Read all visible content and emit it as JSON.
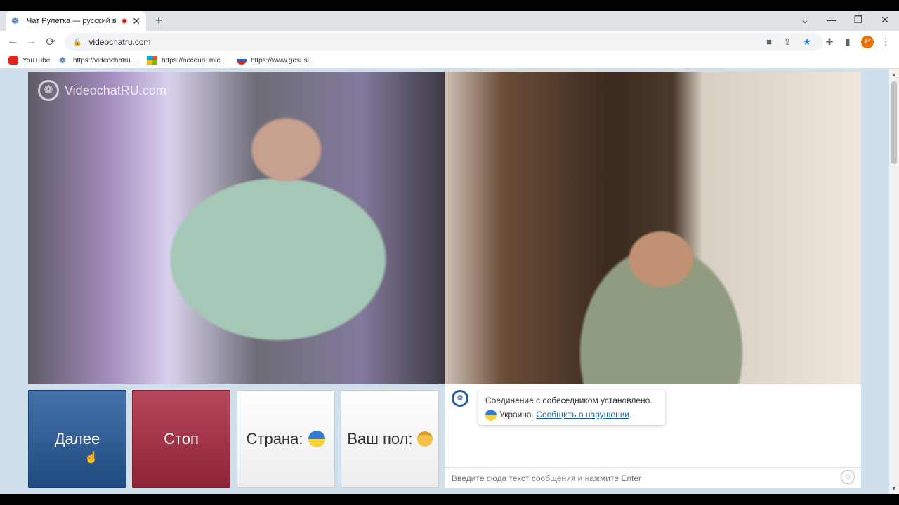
{
  "browser": {
    "tab_title": "Чат Рулетка — русский вид",
    "close_glyph": "✕",
    "new_tab_glyph": "+",
    "url": "videochatru.com",
    "profile_initial": "P",
    "window_controls": {
      "minimize": "—",
      "restore": "❐",
      "close": "✕",
      "tab_search": "⌄"
    },
    "nav": {
      "back": "←",
      "forward": "→",
      "reload": "⟳"
    }
  },
  "bookmarks": [
    {
      "label": "YouTube",
      "icon": "youtube-icon"
    },
    {
      "label": "https://videochatru....",
      "icon": "videochat-icon"
    },
    {
      "label": "https://account.mic...",
      "icon": "microsoft-icon"
    },
    {
      "label": "https://www.gosusl...",
      "icon": "gosuslugi-icon"
    }
  ],
  "site": {
    "logo_text": "VideochatRU.com",
    "logo_glyph": "❁"
  },
  "controls": {
    "next_label": "Далее",
    "stop_label": "Стоп",
    "country_label": "Страна:",
    "gender_label": "Ваш пол:"
  },
  "chat": {
    "connected_message": "Соединение с собеседником установлено.",
    "country_name": "Украина.",
    "report_link": "Сообщить о нарушении",
    "report_suffix": ".",
    "input_placeholder": "Введите сюда текст сообщения и нажмите Enter",
    "emoji_glyph": "☺"
  },
  "colors": {
    "next_button": "#2f5d94",
    "stop_button": "#a3324a",
    "page_background": "#cfe0ec"
  }
}
